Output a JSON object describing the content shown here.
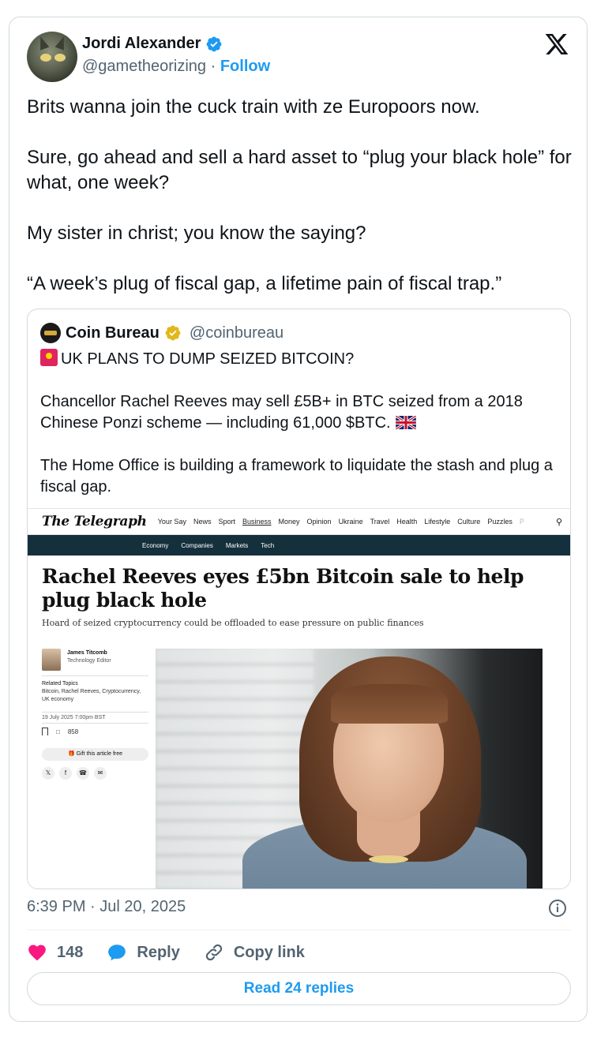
{
  "author": {
    "display_name": "Jordi Alexander",
    "handle": "@gametheorizing",
    "separator": " · ",
    "follow_label": "Follow"
  },
  "tweet": {
    "paragraphs": [
      "Brits wanna join the cuck train with ze Europoors now.",
      "Sure, go ahead and sell a hard asset to “plug your black hole” for what, one week?",
      "My sister in christ; you know the saying?",
      "“A week’s plug of fiscal gap, a lifetime pain of fiscal trap.”"
    ]
  },
  "quote": {
    "display_name": "Coin Bureau",
    "handle": "@coinbureau",
    "line1": "UK PLANS TO DUMP SEIZED BITCOIN?",
    "line2": "Chancellor Rachel Reeves may sell £5B+ in BTC seized from a 2018 Chinese Ponzi scheme — including 61,000 $BTC.",
    "line3": "The Home Office is building a framework to liquidate the stash and plug a fiscal gap.",
    "article": {
      "logo": "The Telegraph",
      "nav": [
        "Your Say",
        "News",
        "Sport",
        "Business",
        "Money",
        "Opinion",
        "Ukraine",
        "Travel",
        "Health",
        "Lifestyle",
        "Culture",
        "Puzzles",
        "P"
      ],
      "subnav": [
        "Economy",
        "Companies",
        "Markets",
        "Tech"
      ],
      "headline": "Rachel Reeves eyes £5bn Bitcoin sale to help plug black hole",
      "standfirst": "Hoard of seized cryptocurrency could be offloaded to ease pressure on public finances",
      "author_name": "James Titcomb",
      "author_role": "Technology Editor",
      "related_header": "Related Topics",
      "related_topics": "Bitcoin, Rachel Reeves, Cryptocurrency, UK economy",
      "date": "19 July 2025 7:00pm BST",
      "comments": "858",
      "gift_label": "Gift this article free"
    }
  },
  "footer": {
    "timestamp": "6:39 PM · Jul 20, 2025",
    "like_count": "148",
    "reply_label": "Reply",
    "copy_link_label": "Copy link",
    "read_replies_label": "Read 24 replies"
  },
  "colors": {
    "accent": "#1d9bf0",
    "text": "#0f1419",
    "muted": "#536471",
    "border": "#cfd9de",
    "like": "#f91880",
    "telegraph_bar": "#15303d"
  }
}
